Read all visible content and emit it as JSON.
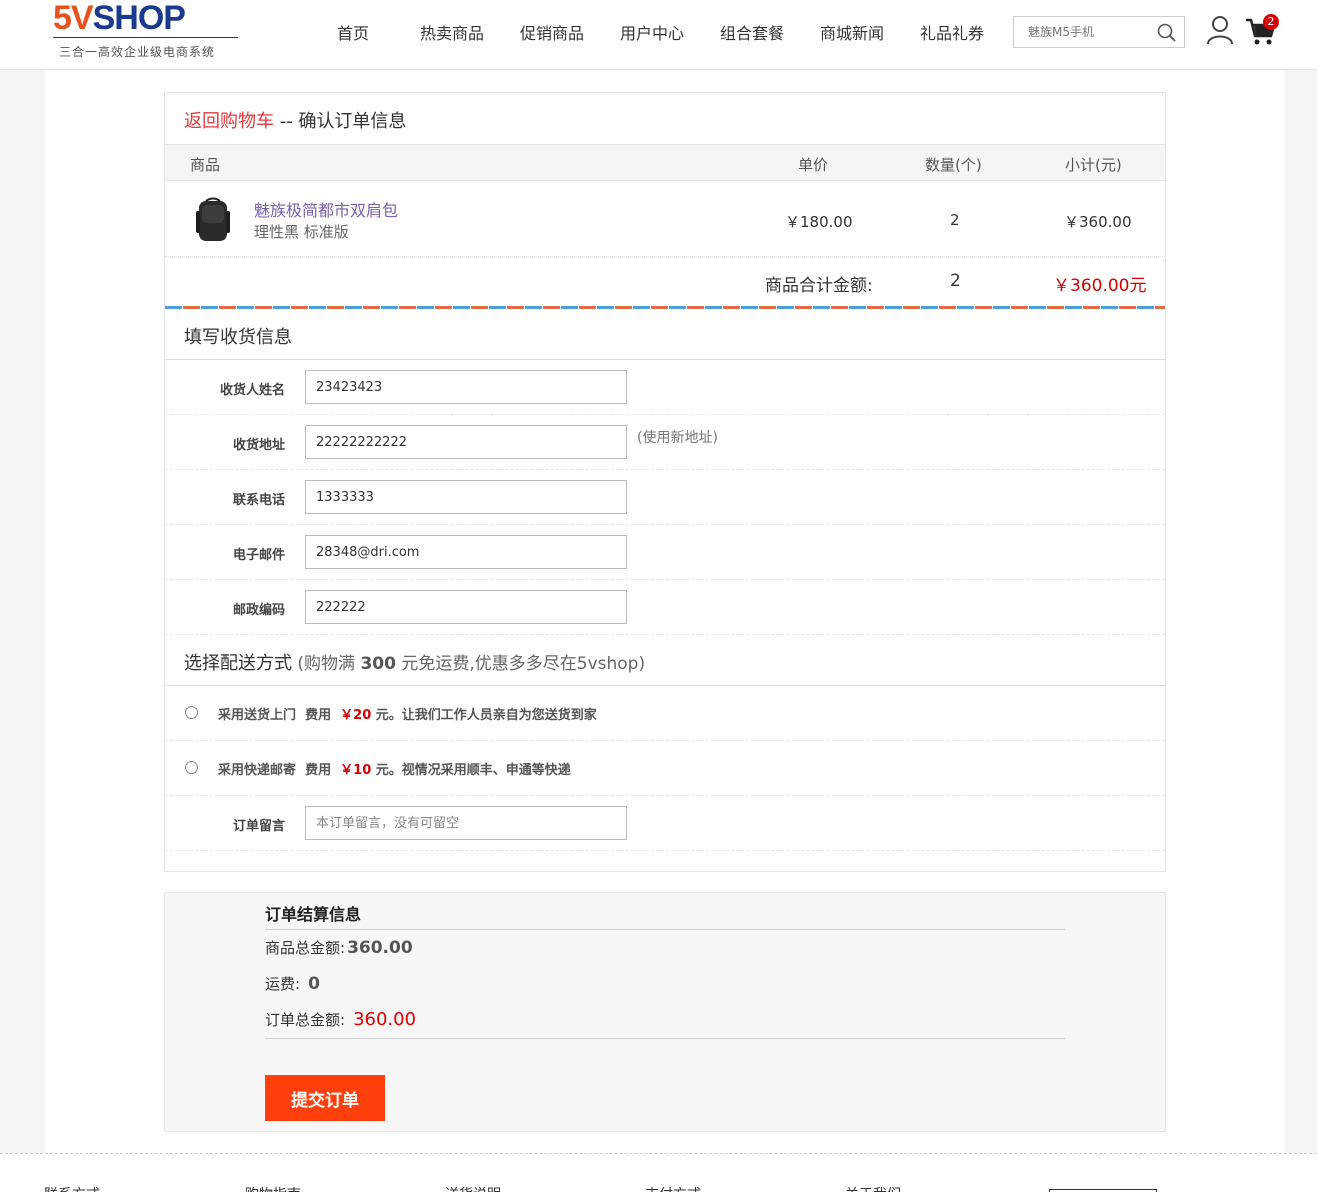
{
  "header": {
    "logo_main_a": "5V",
    "logo_main_b": "SHOP",
    "logo_sub": "三合一高效企业级电商系统",
    "nav": [
      "首页",
      "热卖商品",
      "促销商品",
      "用户中心",
      "组合套餐",
      "商城新闻",
      "礼品礼券"
    ],
    "search_placeholder": "魅族M5手机",
    "cart_count": "2"
  },
  "order": {
    "back_link": "返回购物车",
    "title_sep": " -- ",
    "title": "确认订单信息",
    "columns": {
      "product": "商品",
      "unit_price": "单价",
      "quantity": "数量(个)",
      "subtotal": "小计(元)"
    },
    "items": [
      {
        "name": "魅族极简都市双肩包",
        "spec": "理性黑 标准版",
        "unit_price": "￥180.00",
        "quantity": "2",
        "subtotal": "￥360.00"
      }
    ],
    "total_label": "商品合计金额:",
    "total_qty": "2",
    "total_amount": "￥360.00元"
  },
  "shipping_info": {
    "title": "填写收货信息",
    "fields": [
      {
        "label": "收货人姓名",
        "value": "23423423"
      },
      {
        "label": "收货地址",
        "value": "22222222222",
        "extra": "(使用新地址)"
      },
      {
        "label": "联系电话",
        "value": "1333333"
      },
      {
        "label": "电子邮件",
        "value": "28348@dri.com"
      },
      {
        "label": "邮政编码",
        "value": "222222"
      }
    ]
  },
  "delivery": {
    "title": "选择配送方式",
    "hint_pre": " (购物满 ",
    "hint_amount": "300",
    "hint_post": " 元免运费,优惠多多尽在5vshop)",
    "options": [
      {
        "name": "采用送货上门",
        "fee_label": "费用",
        "fee": "￥20",
        "unit": "元。",
        "desc": "让我们工作人员亲自为您送货到家"
      },
      {
        "name": "采用快递邮寄",
        "fee_label": "费用",
        "fee": "￥10",
        "unit": "元。",
        "desc": "视情况采用顺丰、申通等快递"
      }
    ],
    "note_label": "订单留言",
    "note_placeholder": "本订单留言，没有可留空"
  },
  "summary": {
    "title": "订单结算信息",
    "goods_total_label": "商品总金额:",
    "goods_total": "360.00",
    "freight_label": "运费:",
    "freight": "0",
    "order_total_label": "订单总金额:",
    "order_total": "360.00",
    "submit": "提交订单"
  },
  "footer": [
    "联系方式",
    "购物指南",
    "送货说明",
    "支付方式",
    "关于我们"
  ],
  "colors": {
    "accent_red": "#e4393c",
    "button": "#ff3f0c",
    "price_red": "#e00000",
    "logo_orange": "#e8521c",
    "logo_blue": "#1a3a8f"
  }
}
